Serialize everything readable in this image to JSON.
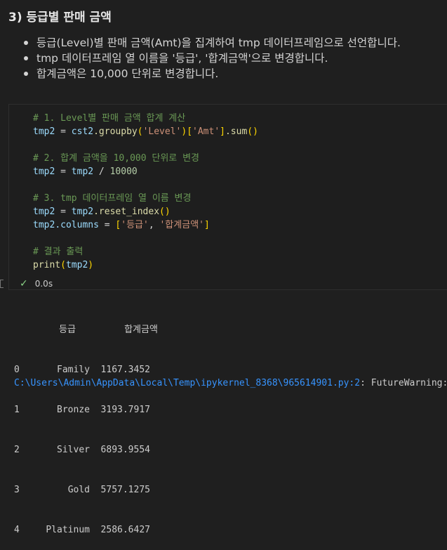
{
  "markdown": {
    "title": "3) 등급별 판매 금액",
    "bullets": [
      "등급(Level)별 판매 금액(Amt)을 집계하여 tmp 데이터프레임으로 선언합니다.",
      "tmp 데이터프레임 열 이름을 '등급', '합계금액'으로 변경합니다.",
      "합계금액은 10,000 단위로 변경합니다."
    ]
  },
  "code": {
    "comment1": "# 1. Level별 판매 금액 합계 계산",
    "var_tmp2": "tmp2",
    "op_assign": " = ",
    "var_cst2": "cst2",
    "fn_groupby": ".groupby",
    "str_level": "'Level'",
    "str_amt": "'Amt'",
    "fn_sum": ".sum",
    "comment2": "# 2. 합계 금액을 10,000 단위로 변경",
    "op_div": " / ",
    "num_10000": "10000",
    "comment3": "# 3. tmp 데이터프레임 열 이름 변경",
    "fn_reset_index": ".reset_index",
    "attr_columns": ".columns",
    "str_grade": "'등급'",
    "str_total": "'합계금액'",
    "comment4": "# 결과 출력",
    "fn_print": "print"
  },
  "status": {
    "check_icon": "✓",
    "duration": "0.0s",
    "success_color": "#89d185"
  },
  "output": {
    "headers": [
      "등급",
      "합계금액"
    ],
    "rows": [
      {
        "index": "0",
        "grade": "Family",
        "amount": "1167.3452"
      },
      {
        "index": "1",
        "grade": "Bronze",
        "amount": "3193.7917"
      },
      {
        "index": "2",
        "grade": "Silver",
        "amount": "6893.9554"
      },
      {
        "index": "3",
        "grade": "Gold",
        "amount": "5757.1275"
      },
      {
        "index": "4",
        "grade": "Platinum",
        "amount": "2586.6427"
      }
    ],
    "warning_path": "C:\\Users\\Admin\\AppData\\Local\\Temp\\ipykernel_8368\\965614901.py:2",
    "warning_tail": ": FutureWarning:"
  }
}
